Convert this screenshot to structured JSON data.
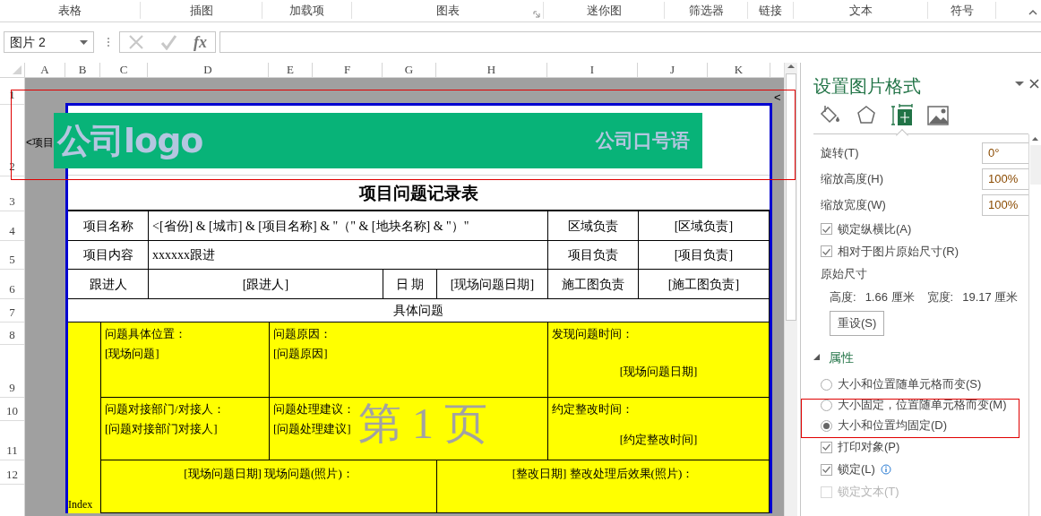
{
  "ribbon": {
    "groups": [
      {
        "label": "表格",
        "launcher": false
      },
      {
        "label": "插图",
        "launcher": false
      },
      {
        "label": "加载项",
        "launcher": false
      },
      {
        "label": "图表",
        "launcher": true
      },
      {
        "label": "迷你图",
        "launcher": false
      },
      {
        "label": "筛选器",
        "launcher": false
      },
      {
        "label": "链接",
        "launcher": false
      },
      {
        "label": "文本",
        "launcher": false
      },
      {
        "label": "符号",
        "launcher": false
      }
    ]
  },
  "formula_bar": {
    "name_box": "图片 2",
    "function_label": "fx"
  },
  "columns": [
    "A",
    "B",
    "C",
    "D",
    "E",
    "F",
    "G",
    "H",
    "I",
    "J",
    "K"
  ],
  "rows": [
    "1",
    "2",
    "3",
    "4",
    "5",
    "6",
    "7",
    "8",
    "9",
    "10",
    "11",
    "12"
  ],
  "sheet": {
    "overflow_text": "<项目",
    "overflow_mark": "<",
    "page_label": "第 1 页",
    "logo": {
      "title": "公司logo",
      "slogan": "公司口号语"
    },
    "form": {
      "title": "项目问题记录表",
      "info_rows": [
        [
          "项目名称",
          "<[省份] & [城市] & [项目名称] & \"（\" & [地块名称]  & \"）\"",
          "区域负责",
          "[区域负责]"
        ],
        [
          "项目内容",
          "xxxxxx跟进",
          "项目负责",
          "[项目负责]"
        ],
        [
          "跟进人",
          "[跟进人]",
          "日 期",
          "[现场问题日期]",
          "施工图负责",
          "[施工图负责]"
        ]
      ],
      "section_title": "具体问题",
      "issue_cells": [
        {
          "label": "问题具体位置：",
          "value": "[现场问题]"
        },
        {
          "label": "问题原因：",
          "value": "[问题原因]"
        },
        {
          "label": "发现问题时间：",
          "value": "[现场问题日期]"
        },
        {
          "label": "问题对接部门/对接人：",
          "value": "[问题对接部门对接人]"
        },
        {
          "label": "问题处理建议：",
          "value": "[问题处理建议]"
        },
        {
          "label": "约定整改时间：",
          "value": "[约定整改时间]"
        }
      ],
      "photo_cells": [
        "[现场问题日期] 现场问题(照片)：",
        "[整改日期] 整改处理后效果(照片)："
      ],
      "index_label": "Index"
    }
  },
  "format_pane": {
    "title": "设置图片格式",
    "tabs": [
      {
        "kind": "fill",
        "selected": false
      },
      {
        "kind": "effects",
        "selected": false
      },
      {
        "kind": "size",
        "selected": true
      },
      {
        "kind": "picture",
        "selected": false
      }
    ],
    "fields": [
      {
        "label": "旋转(T)",
        "value": "0°"
      },
      {
        "label": "缩放高度(H)",
        "value": "100%"
      },
      {
        "label": "缩放宽度(W)",
        "value": "100%"
      }
    ],
    "checks": [
      {
        "label": "锁定纵横比(A)",
        "checked": true
      },
      {
        "label": "相对于图片原始尺寸(R)",
        "checked": true
      }
    ],
    "original_size": {
      "heading": "原始尺寸",
      "height_label": "高度:",
      "height": "1.66 厘米",
      "width_label": "宽度:",
      "width": "19.17 厘米"
    },
    "reset_button": "重设(S)",
    "properties": {
      "heading": "属性",
      "expanded": true,
      "options": [
        {
          "label": "大小和位置随单元格而变(S)",
          "selected": false
        },
        {
          "label": "大小固定，位置随单元格而变(M)",
          "selected": false
        },
        {
          "label": "大小和位置均固定(D)",
          "selected": true
        }
      ],
      "checks": [
        {
          "label": "打印对象(P)",
          "checked": true,
          "disabled": false,
          "info": false
        },
        {
          "label": "锁定(L)",
          "checked": true,
          "disabled": false,
          "info": true
        },
        {
          "label": "锁定文本(T)",
          "checked": false,
          "disabled": true,
          "info": false
        }
      ]
    }
  }
}
